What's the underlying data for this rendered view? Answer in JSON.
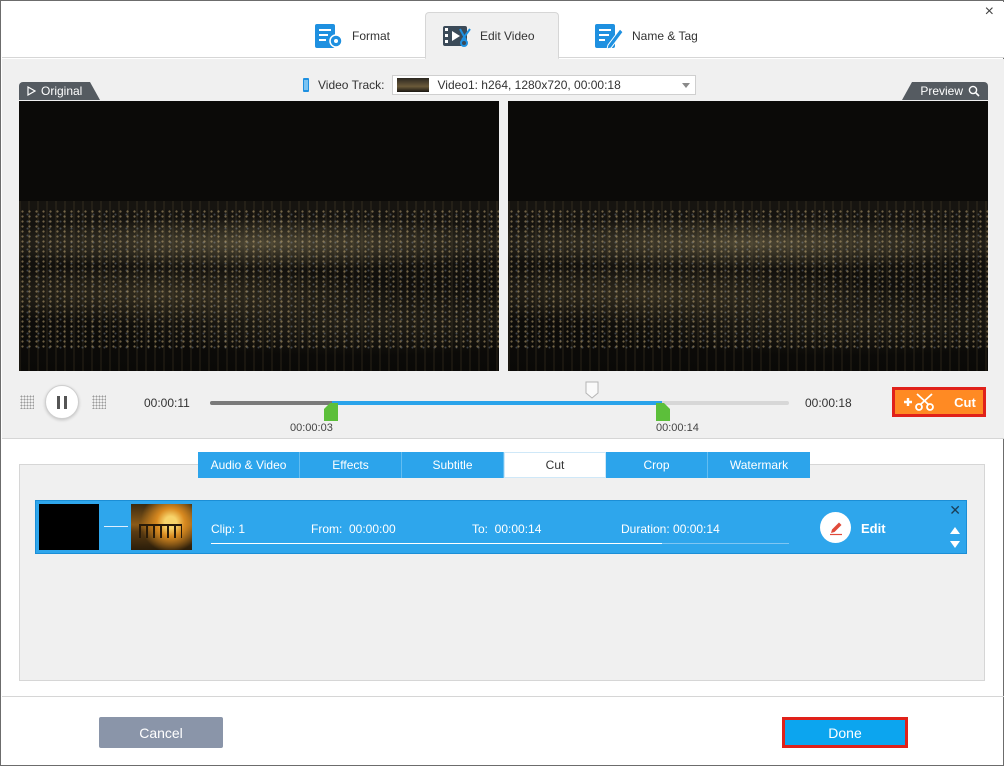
{
  "window": {
    "close_glyph": "×"
  },
  "top_tabs": [
    {
      "label": "Format",
      "icon": "format-settings-icon"
    },
    {
      "label": "Edit Video",
      "icon": "edit-video-icon",
      "active": true
    },
    {
      "label": "Name & Tag",
      "icon": "name-tag-icon"
    }
  ],
  "preview": {
    "original_label": "Original",
    "preview_label": "Preview",
    "video_track_label": "Video Track:",
    "video_track_value": "Video1: h264, 1280x720, 00:00:18"
  },
  "playback": {
    "current_time": "00:00:11",
    "total_time": "00:00:18",
    "marker_start": "00:00:03",
    "marker_end": "00:00:14",
    "played_fraction": 0.21,
    "selection_start_fraction": 0.21,
    "selection_end_fraction": 0.78,
    "playhead_fraction": 0.66,
    "cut_label": "Cut"
  },
  "edit_tabs": [
    {
      "label": "Audio & Video"
    },
    {
      "label": "Effects"
    },
    {
      "label": "Subtitle"
    },
    {
      "label": "Cut",
      "active": true
    },
    {
      "label": "Crop"
    },
    {
      "label": "Watermark"
    }
  ],
  "clip": {
    "clip_label": "Clip: 1",
    "from_label": "From:  00:00:00",
    "to_label": "To:  00:00:14",
    "duration_label": "Duration: 00:00:14",
    "edit_label": "Edit",
    "progress_fraction": 0.78
  },
  "footer": {
    "cancel_label": "Cancel",
    "done_label": "Done"
  },
  "colors": {
    "accent_blue": "#2ca4eb",
    "cut_orange": "#ff8a23",
    "highlight_red": "#e0211a",
    "cancel_gray": "#8a95a9",
    "marker_green": "#5cbf3a"
  }
}
